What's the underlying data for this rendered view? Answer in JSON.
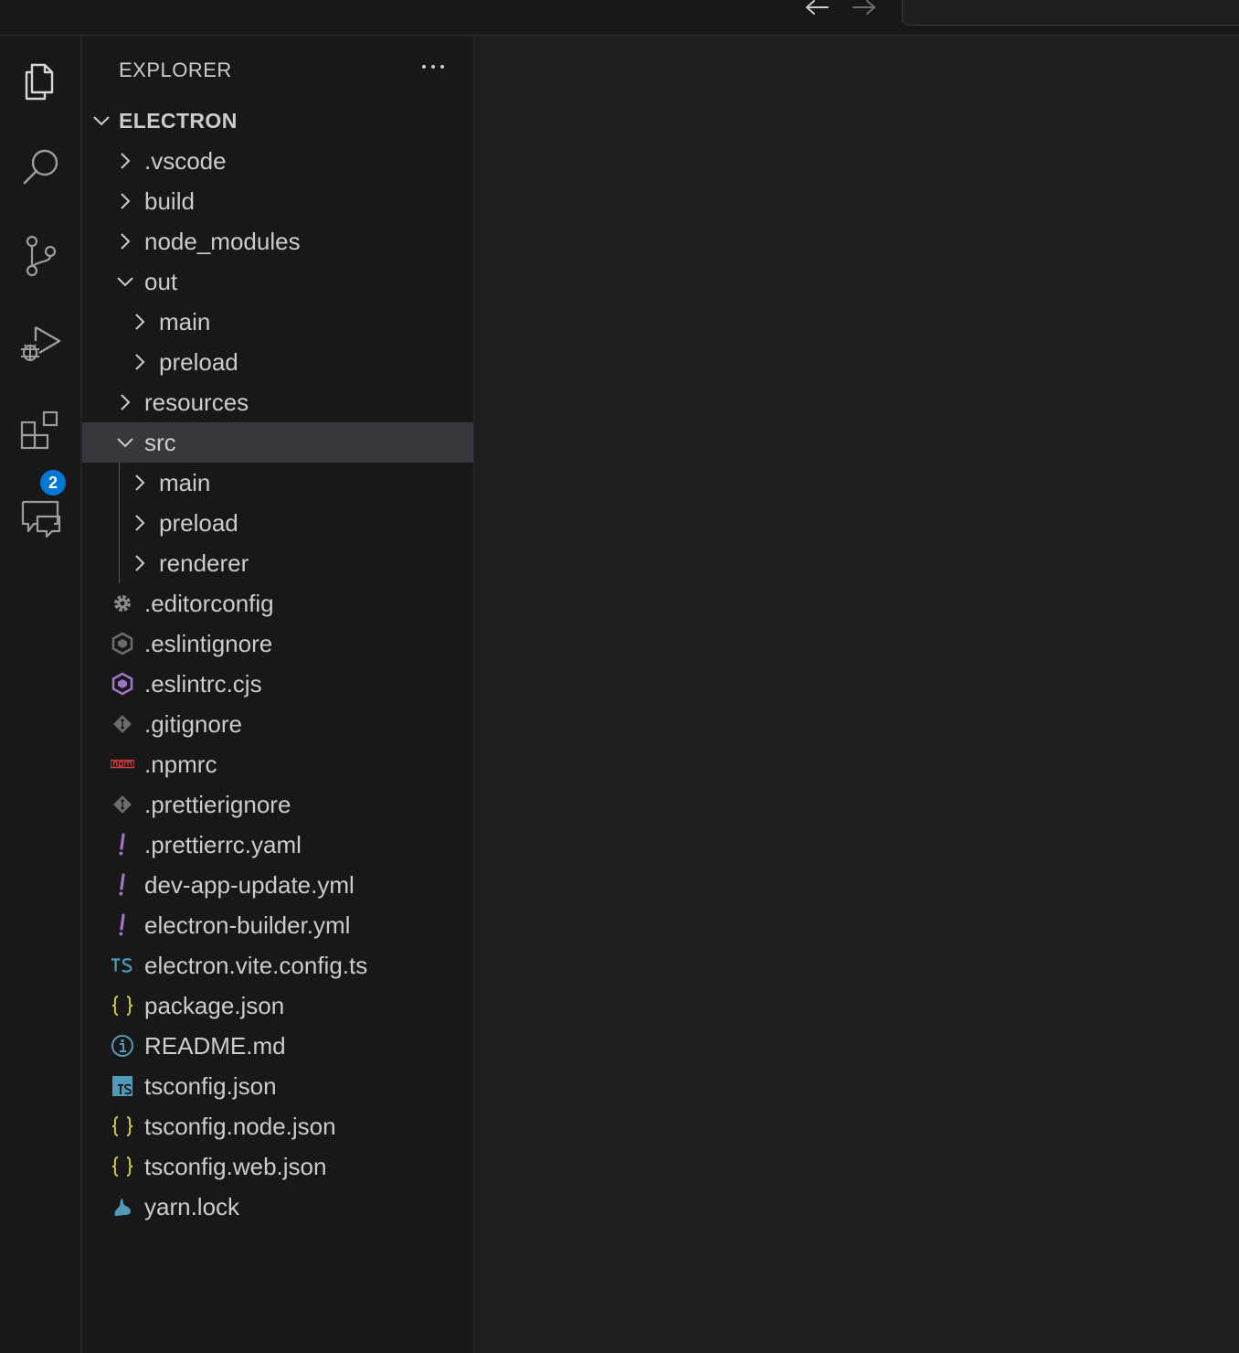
{
  "titlebar": {
    "back_icon": "arrow-left-icon",
    "forward_icon": "arrow-right-icon"
  },
  "activitybar": {
    "items": [
      {
        "name": "explorer",
        "icon": "files-icon"
      },
      {
        "name": "search",
        "icon": "search-icon"
      },
      {
        "name": "source-control",
        "icon": "source-control-icon"
      },
      {
        "name": "run-and-debug",
        "icon": "run-debug-icon"
      },
      {
        "name": "extensions",
        "icon": "extensions-icon",
        "badge": "2"
      },
      {
        "name": "chat",
        "icon": "chat-icon"
      }
    ]
  },
  "sidebar": {
    "title": "EXPLORER",
    "more_actions_icon": "ellipsis-icon",
    "root": "ELECTRON",
    "folders": {
      "vscode": ".vscode",
      "build": "build",
      "node_modules": "node_modules",
      "out": "out",
      "out_main": "main",
      "out_preload": "preload",
      "resources": "resources",
      "src": "src",
      "src_main": "main",
      "src_preload": "preload",
      "src_renderer": "renderer"
    },
    "files": [
      {
        "label": ".editorconfig",
        "icon": "gear-icon",
        "color": "#8a8a8a"
      },
      {
        "label": ".eslintignore",
        "icon": "eslint-icon",
        "color": "#6b6b6b"
      },
      {
        "label": ".eslintrc.cjs",
        "icon": "eslint-icon",
        "color": "#a074c4"
      },
      {
        "label": ".gitignore",
        "icon": "git-icon",
        "color": "#6b6b6b"
      },
      {
        "label": ".npmrc",
        "icon": "npm-icon",
        "color": "#cc3e44"
      },
      {
        "label": ".prettierignore",
        "icon": "git-icon",
        "color": "#6b6b6b"
      },
      {
        "label": ".prettierrc.yaml",
        "icon": "yaml-icon",
        "color": "#a074c4"
      },
      {
        "label": "dev-app-update.yml",
        "icon": "yaml-icon",
        "color": "#a074c4"
      },
      {
        "label": "electron-builder.yml",
        "icon": "yaml-icon",
        "color": "#a074c4"
      },
      {
        "label": "electron.vite.config.ts",
        "icon": "typescript-icon",
        "color": "#519aba"
      },
      {
        "label": "package.json",
        "icon": "json-icon",
        "color": "#cbcb41"
      },
      {
        "label": "README.md",
        "icon": "info-icon",
        "color": "#519aba"
      },
      {
        "label": "tsconfig.json",
        "icon": "tsconfig-icon",
        "color": "#519aba"
      },
      {
        "label": "tsconfig.node.json",
        "icon": "json-icon",
        "color": "#cbcb41"
      },
      {
        "label": "tsconfig.web.json",
        "icon": "json-icon",
        "color": "#cbcb41"
      },
      {
        "label": "yarn.lock",
        "icon": "yarn-icon",
        "color": "#519aba"
      }
    ]
  },
  "colors": {
    "background": "#1f1f1f",
    "sidebar": "#181818",
    "selection": "#37373d",
    "badge": "#0078d4"
  }
}
